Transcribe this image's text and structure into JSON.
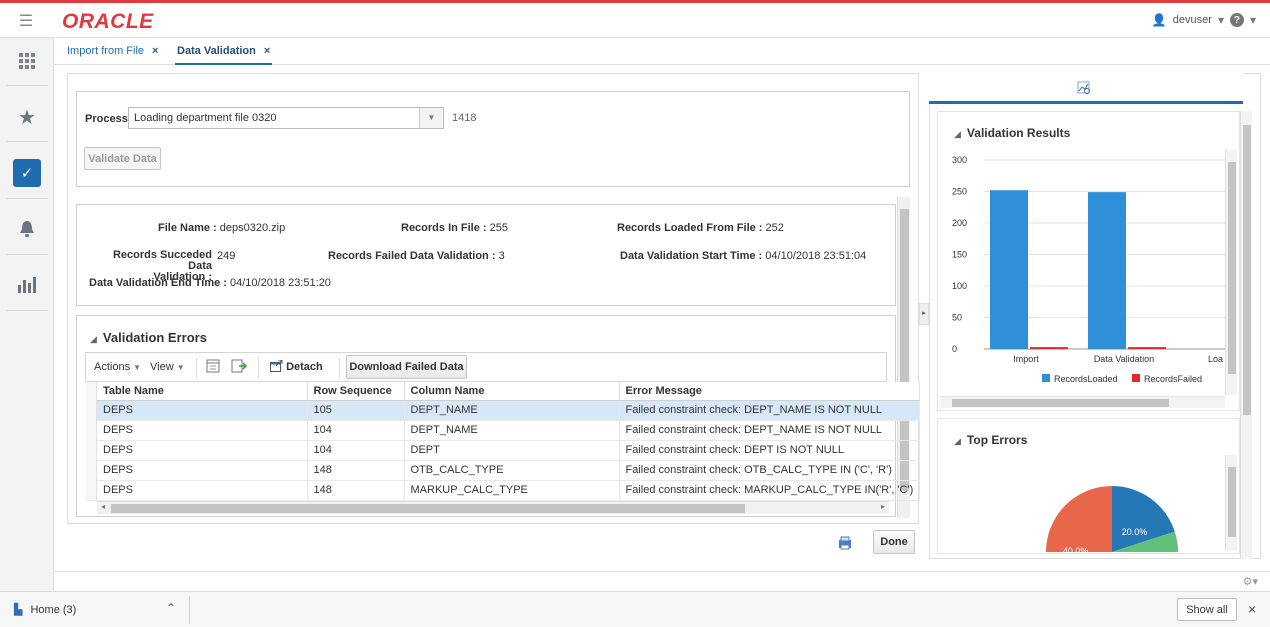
{
  "app": {
    "logo": "ORACLE",
    "user": "devuser",
    "help": "?"
  },
  "tabs": [
    {
      "label": "Import from File",
      "close": "×"
    },
    {
      "label": "Data Validation",
      "close": "×"
    }
  ],
  "process": {
    "label": "Process",
    "value": "Loading department file 0320",
    "id": "1418",
    "validate_button": "Validate Data"
  },
  "summary": {
    "file_name_label": "File Name :",
    "file_name": "deps0320.zip",
    "records_in_file_label": "Records In File :",
    "records_in_file": "255",
    "records_loaded_label": "Records Loaded From File :",
    "records_loaded": "252",
    "succeeded_label_1": "Records Succeded Data",
    "succeeded_label_2": "Validation :",
    "succeeded": "249",
    "failed_label": "Records Failed Data Validation :",
    "failed": "3",
    "start_label": "Data Validation Start Time :",
    "start": "04/10/2018 23:51:04",
    "end_label": "Data Validation End Time :",
    "end": "04/10/2018 23:51:20"
  },
  "errors_section": {
    "title": "Validation Errors",
    "toolbar": {
      "actions": "Actions",
      "view": "View",
      "detach": "Detach",
      "download": "Download Failed Data"
    },
    "columns": [
      "Table Name",
      "Row Sequence",
      "Column Name",
      "Error Message"
    ],
    "rows": [
      [
        "DEPS",
        "105",
        "DEPT_NAME",
        "Failed constraint check: DEPT_NAME IS NOT NULL"
      ],
      [
        "DEPS",
        "104",
        "DEPT_NAME",
        "Failed constraint check: DEPT_NAME IS NOT NULL"
      ],
      [
        "DEPS",
        "104",
        "DEPT",
        "Failed constraint check: DEPT IS NOT NULL"
      ],
      [
        "DEPS",
        "148",
        "OTB_CALC_TYPE",
        "Failed constraint check: OTB_CALC_TYPE IN ('C', 'R')"
      ],
      [
        "DEPS",
        "148",
        "MARKUP_CALC_TYPE",
        "Failed constraint check: MARKUP_CALC_TYPE IN('R', 'C')"
      ]
    ]
  },
  "done_button": "Done",
  "validation_results": {
    "title": "Validation Results",
    "chart_data": {
      "type": "bar",
      "categories": [
        "Import",
        "Data Validation",
        "Loa"
      ],
      "series": [
        {
          "name": "RecordsLoaded",
          "values": [
            252,
            249,
            null
          ],
          "color": "#2f8fd8"
        },
        {
          "name": "RecordsFailed",
          "values": [
            3,
            3,
            null
          ],
          "color": "#e8262a"
        }
      ],
      "yticks": [
        "0",
        "50",
        "100",
        "150",
        "200",
        "250",
        "300"
      ],
      "ylim": [
        0,
        300
      ],
      "legend": "bottom"
    }
  },
  "top_errors": {
    "title": "Top Errors",
    "chart_data": {
      "type": "pie",
      "slices": [
        {
          "label": "40.0%",
          "value": 40,
          "color": "#e8674a"
        },
        {
          "label": "20.0%",
          "value": 20,
          "color": "#2577b5"
        },
        {
          "label": "",
          "value": 10,
          "color": "#63c07a"
        }
      ]
    }
  },
  "taskbar": {
    "home": "Home (3)",
    "show_all": "Show all",
    "close": "×"
  }
}
